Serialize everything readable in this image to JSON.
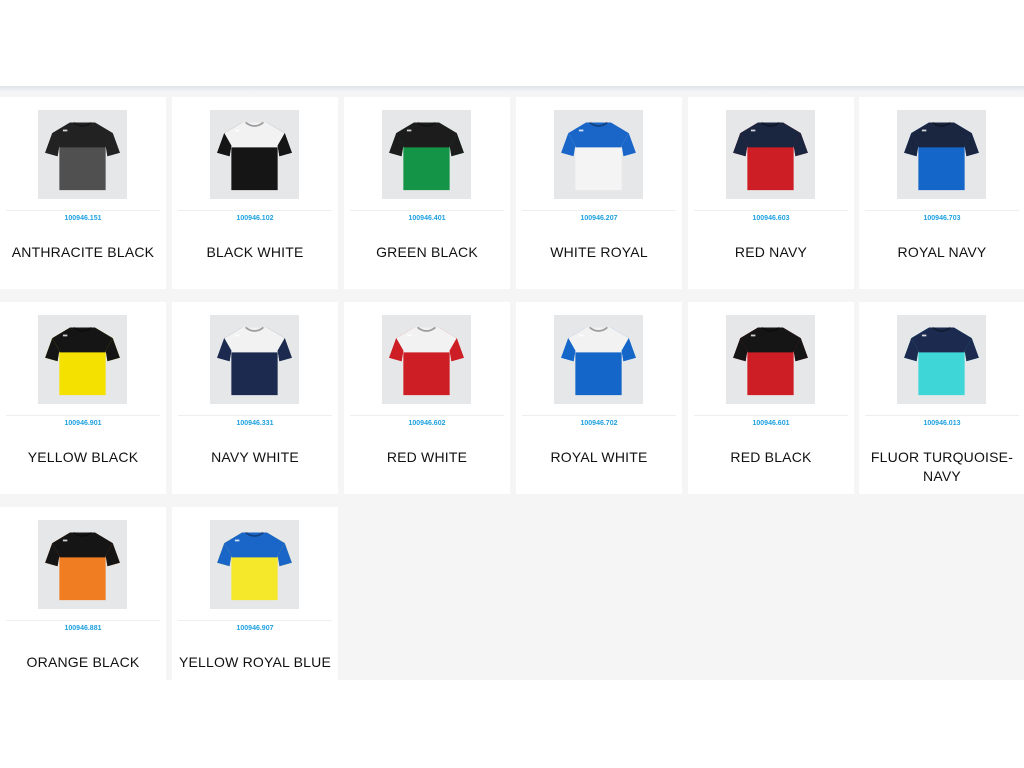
{
  "products": [
    {
      "code": "100946.151",
      "name": "ANTHRACITE BLACK",
      "colors": {
        "body": "#505050",
        "top": "#222222",
        "sleeve": "#222222"
      }
    },
    {
      "code": "100946.102",
      "name": "BLACK WHITE",
      "colors": {
        "body": "#151515",
        "top": "#f2f2f2",
        "sleeve": "#151515"
      }
    },
    {
      "code": "100946.401",
      "name": "GREEN BLACK",
      "colors": {
        "body": "#149447",
        "top": "#1c1c1c",
        "sleeve": "#1c1c1c"
      }
    },
    {
      "code": "100946.207",
      "name": "WHITE ROYAL",
      "colors": {
        "body": "#f4f4f4",
        "top": "#1a66c8",
        "sleeve": "#1a66c8"
      }
    },
    {
      "code": "100946.603",
      "name": "RED NAVY",
      "colors": {
        "body": "#cc1e24",
        "top": "#1a2540",
        "sleeve": "#1a2540"
      }
    },
    {
      "code": "100946.703",
      "name": "ROYAL NAVY",
      "colors": {
        "body": "#1467c9",
        "top": "#1a2540",
        "sleeve": "#1a2540"
      }
    },
    {
      "code": "100946.901",
      "name": "YELLOW BLACK",
      "colors": {
        "body": "#f5e100",
        "top": "#151515",
        "sleeve": "#151515"
      }
    },
    {
      "code": "100946.331",
      "name": "NAVY WHITE",
      "colors": {
        "body": "#1b2a4e",
        "top": "#f2f2f2",
        "sleeve": "#1b2a4e"
      }
    },
    {
      "code": "100946.602",
      "name": "RED WHITE",
      "colors": {
        "body": "#cc1e24",
        "top": "#f2f2f2",
        "sleeve": "#cc1e24"
      }
    },
    {
      "code": "100946.702",
      "name": "ROYAL WHITE",
      "colors": {
        "body": "#1467c9",
        "top": "#f2f2f2",
        "sleeve": "#1467c9"
      }
    },
    {
      "code": "100946.601",
      "name": "RED BLACK",
      "colors": {
        "body": "#cc1e24",
        "top": "#151515",
        "sleeve": "#151515"
      }
    },
    {
      "code": "100946.013",
      "name": "FLUOR TURQUOISE-NAVY",
      "colors": {
        "body": "#3fd6d8",
        "top": "#1b2a4e",
        "sleeve": "#1b2a4e"
      }
    },
    {
      "code": "100946.881",
      "name": "ORANGE BLACK",
      "colors": {
        "body": "#f07d22",
        "top": "#151515",
        "sleeve": "#151515"
      }
    },
    {
      "code": "100946.907",
      "name": "YELLOW ROYAL BLUE",
      "colors": {
        "body": "#f5e72a",
        "top": "#1a66c8",
        "sleeve": "#1a66c8"
      }
    }
  ]
}
